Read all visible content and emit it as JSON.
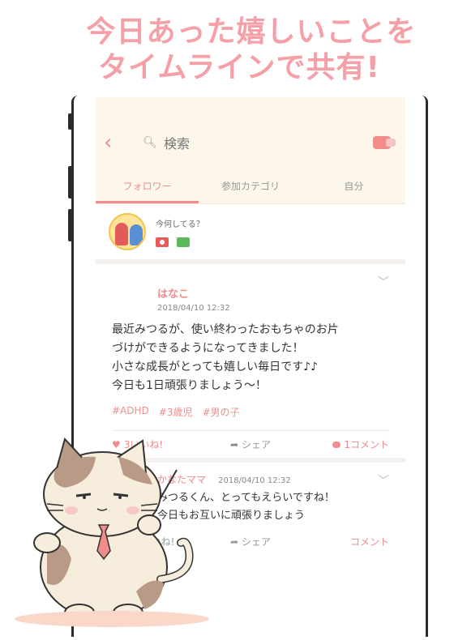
{
  "headline": {
    "line1": "今日あった嬉しいことを",
    "line2": "タイムラインで共有!"
  },
  "search": {
    "label": "検索"
  },
  "tabs": [
    {
      "label": "フォロワー",
      "active": true
    },
    {
      "label": "参加カテゴリ",
      "active": false
    },
    {
      "label": "自分",
      "active": false
    }
  ],
  "compose": {
    "prompt": "今何してる？"
  },
  "post1": {
    "author": "はなこ",
    "date": "2018/04/10 12:32",
    "body_lines": [
      "最近みつるが、使い終わったおもちゃのお片",
      "づけができるようになってきました！",
      "小さな成長がとっても嬉しい毎日です♪♪",
      "今日も1日頑張りましょう〜！"
    ],
    "tags": [
      "#ADHD",
      "#3歳児",
      "#男の子"
    ],
    "like_label": "3いいね!",
    "share_label": "シェア",
    "comment_label": "1コメント"
  },
  "post2": {
    "author": "かなたママ",
    "date": "2018/04/10 12:32",
    "body_lines": [
      "みつるくん、とってもえらいですね！",
      "今日もお互いに頑張りましょう"
    ],
    "like_label": "いいね!",
    "share_label": "シェア",
    "comment_label": "コメント"
  },
  "colors": {
    "accent": "#f08c8c",
    "headline": "#f4a0a6",
    "header_bg": "#fdf6ea"
  }
}
